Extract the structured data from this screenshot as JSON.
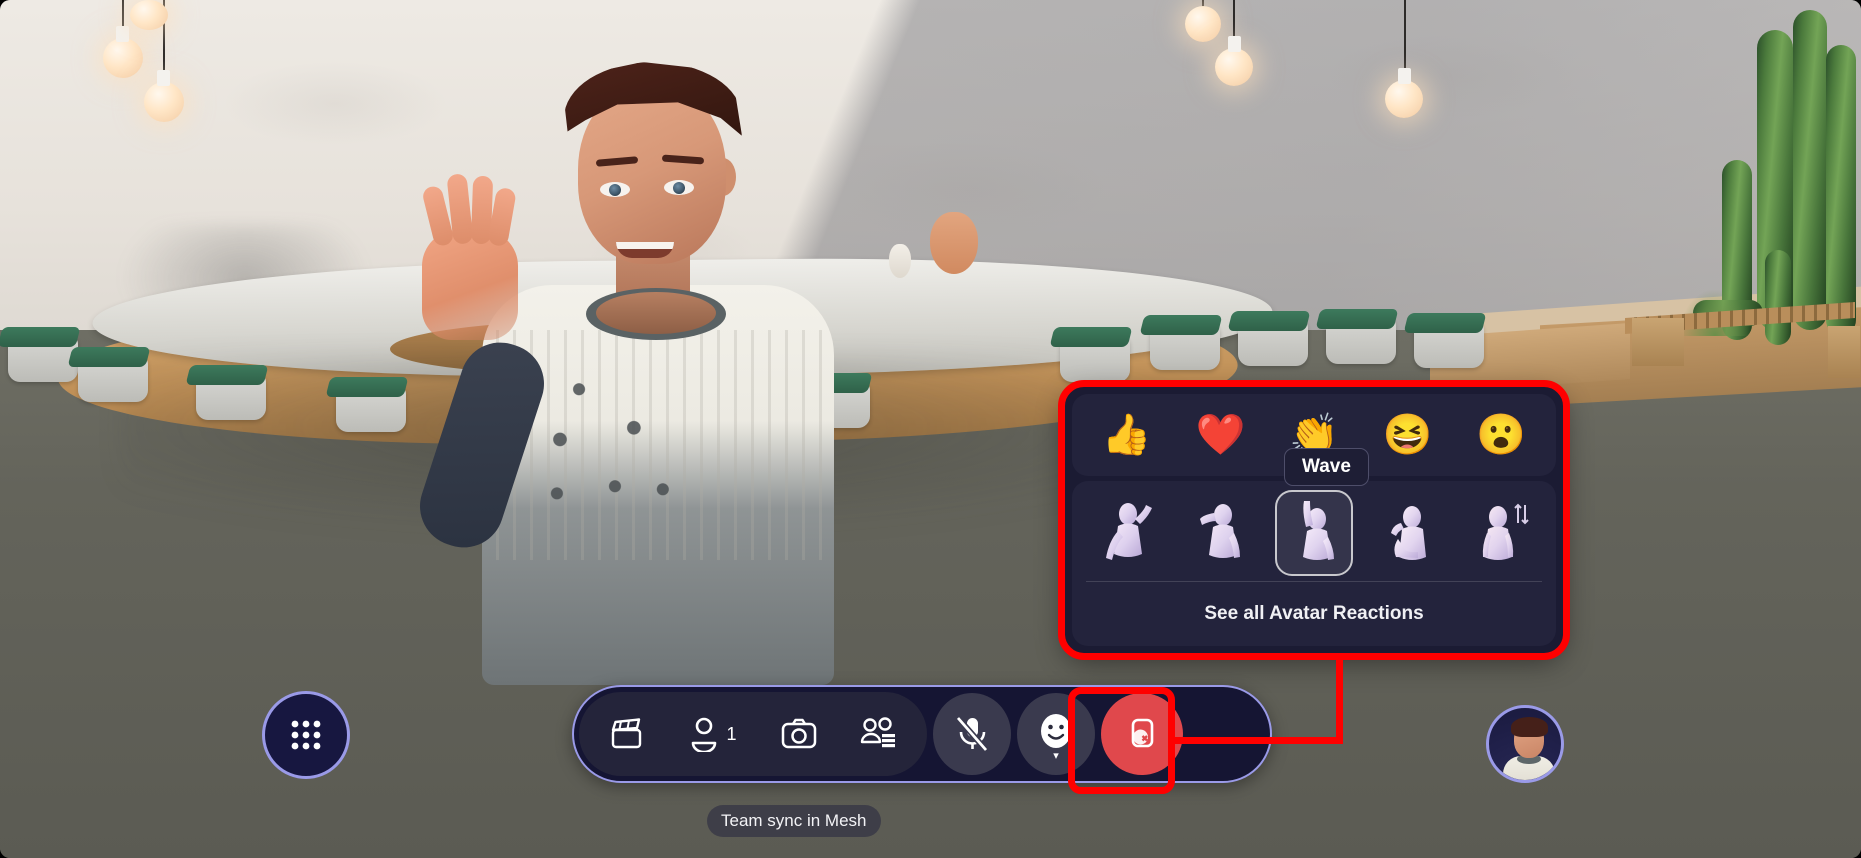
{
  "app": {
    "meeting_label": "Team sync in Mesh"
  },
  "toolbar": {
    "items": [
      {
        "name": "clips",
        "icon": "clapperboard-icon",
        "label": "Clips"
      },
      {
        "name": "participants",
        "icon": "people-icon",
        "label": "People",
        "count": "1"
      },
      {
        "name": "camera",
        "icon": "camera-icon",
        "label": "Camera"
      },
      {
        "name": "view",
        "icon": "view-switch-icon",
        "label": "View"
      }
    ],
    "mic": {
      "name": "microphone",
      "icon": "mic-muted-icon",
      "label": "Mic muted",
      "state": "muted"
    },
    "reactions": {
      "name": "reactions",
      "icon": "smiley-face-icon",
      "label": "Reactions",
      "expanded": true
    },
    "leave": {
      "name": "leave",
      "icon": "leave-call-icon",
      "label": "Leave"
    },
    "app_launcher": {
      "name": "app-launcher",
      "icon": "grid-dots-icon",
      "label": "Apps"
    },
    "self_view": {
      "name": "self-view",
      "icon": "avatar-thumbnail",
      "label": "You"
    }
  },
  "reactions_panel": {
    "emoji_row": [
      {
        "name": "thumbs-up",
        "glyph": "👍",
        "label": "Like"
      },
      {
        "name": "heart",
        "glyph": "❤️",
        "label": "Love"
      },
      {
        "name": "applause",
        "glyph": "👏",
        "label": "Applause"
      },
      {
        "name": "laugh",
        "glyph": "😆",
        "label": "Laugh"
      },
      {
        "name": "surprised",
        "glyph": "😮",
        "label": "Surprised"
      }
    ],
    "avatar_row": [
      {
        "name": "celebrate",
        "label": "Celebrate",
        "selected": false
      },
      {
        "name": "salute",
        "label": "Salute",
        "selected": false
      },
      {
        "name": "raise-hand",
        "label": "Raise hand",
        "selected": true
      },
      {
        "name": "wave",
        "label": "Wave",
        "selected": false
      },
      {
        "name": "more-gestures",
        "label": "More",
        "selected": false
      }
    ],
    "see_all_label": "See all Avatar Reactions",
    "tooltip": "Wave"
  },
  "colors": {
    "annotation": "#ff0000",
    "panel_bg": "#1b1b33",
    "row_bg": "#23233c",
    "toolbar_bg": "#151533",
    "toolbar_border": "#9a9ae8",
    "leave_red": "#e0484c",
    "selected_outline": "#c8c8cd"
  }
}
